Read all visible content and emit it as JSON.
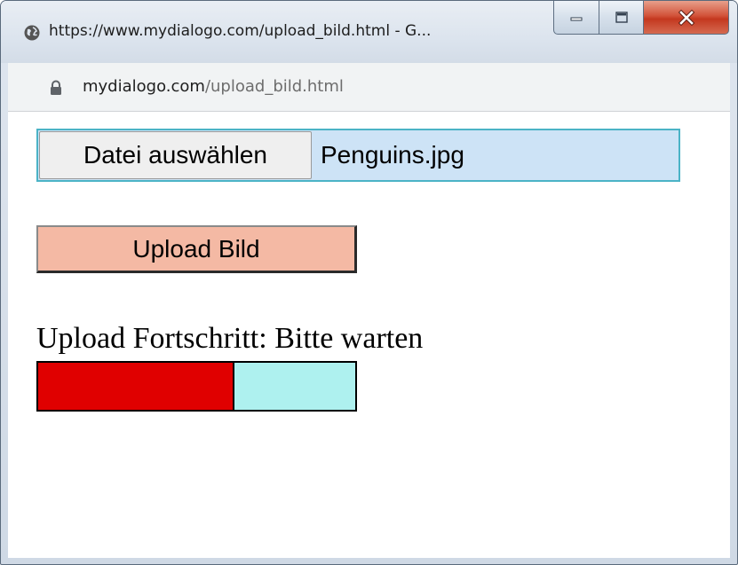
{
  "window": {
    "title": "https://www.mydialogo.com/upload_bild.html - G..."
  },
  "address_bar": {
    "host": "mydialogo.com",
    "path": "/upload_bild.html"
  },
  "form": {
    "file_button_label": "Datei auswählen",
    "file_name": "Penguins.jpg",
    "upload_button_label": "Upload Bild"
  },
  "progress": {
    "label": "Upload Fortschritt: Bitte warten",
    "fraction": 0.62
  },
  "colors": {
    "file_input_background": "#cde3f6",
    "upload_button_background": "#f4b9a4",
    "progress_fill": "#e00000",
    "progress_track": "#aef1ef"
  },
  "icons": {
    "title_icon": "globe-icon",
    "address_icon": "lock-icon",
    "window_controls": [
      "minimize-icon",
      "maximize-icon",
      "close-icon"
    ]
  }
}
